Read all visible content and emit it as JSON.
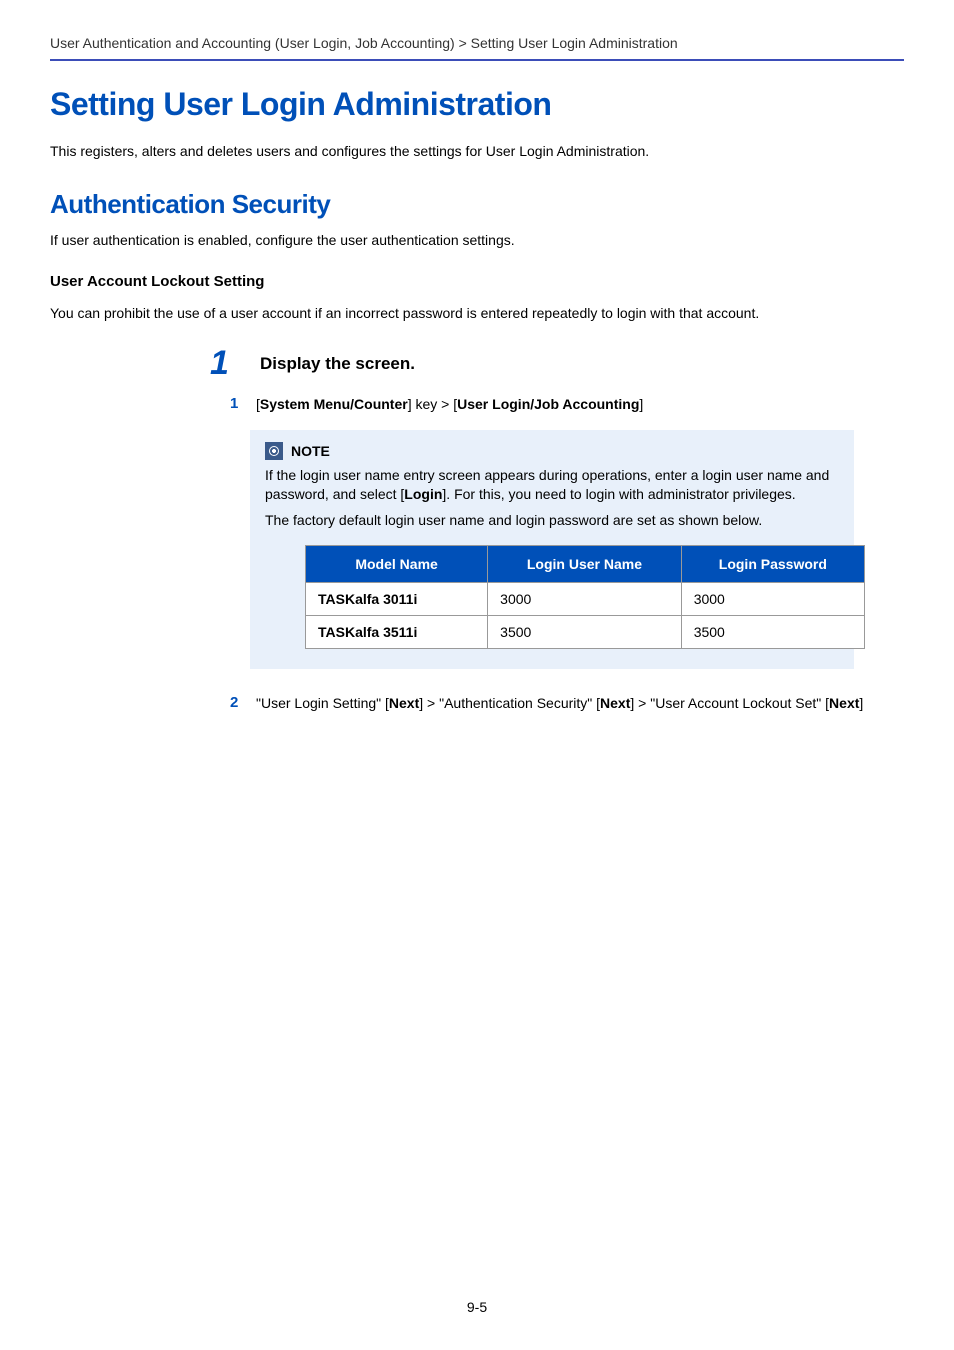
{
  "breadcrumb": "User Authentication and Accounting (User Login, Job Accounting) > Setting User Login Administration",
  "h1": "Setting User Login Administration",
  "intro": "This registers, alters and deletes users and configures the settings for User Login Administration.",
  "h2": "Authentication Security",
  "auth_intro": "If user authentication is enabled, configure the user authentication settings.",
  "h3": "User Account Lockout Setting",
  "lockout_intro": "You can prohibit the use of a user account if an incorrect password is entered repeatedly to login with that account.",
  "step1": {
    "num": "1",
    "title": "Display the screen."
  },
  "substep1": {
    "num": "1",
    "prefix": "[",
    "key1": "System Menu/Counter",
    "mid": "] key > [",
    "key2": "User Login/Job Accounting",
    "suffix": "]"
  },
  "note": {
    "label": "NOTE",
    "p1_a": "If the login user name entry screen appears during operations, enter a login user name and password, and select [",
    "p1_login": "Login",
    "p1_b": "]. For this, you need to login with administrator privileges.",
    "p2": "The factory default login user name and login password are set as shown below."
  },
  "table": {
    "headers": [
      "Model Name",
      "Login User Name",
      "Login Password"
    ],
    "rows": [
      {
        "model": "TASKalfa 3011i",
        "user": "3000",
        "pass": "3000"
      },
      {
        "model": "TASKalfa 3511i",
        "user": "3500",
        "pass": "3500"
      }
    ]
  },
  "substep2": {
    "num": "2",
    "a": "\"User Login Setting\" [",
    "n1": "Next",
    "b": "] > \"Authentication Security\" [",
    "n2": "Next",
    "c": "] > \"User Account Lockout Set\" [",
    "n3": "Next",
    "d": "]"
  },
  "page_number": "9-5"
}
